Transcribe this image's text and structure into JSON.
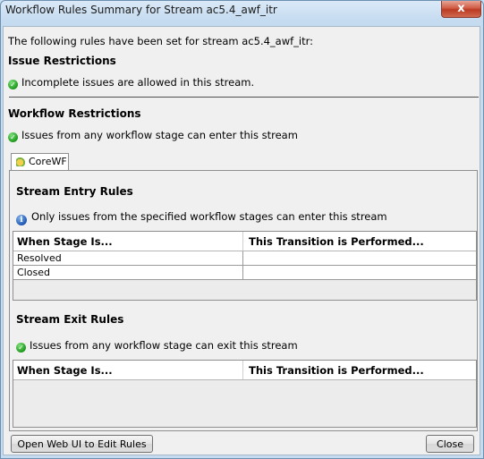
{
  "window": {
    "title": "Workflow Rules Summary for Stream ac5.4_awf_itr",
    "close_glyph": "x"
  },
  "intro": "The following rules have been set for stream ac5.4_awf_itr:",
  "issue_restrictions": {
    "heading": "Issue Restrictions",
    "message": "Incomplete issues are allowed in this stream."
  },
  "workflow_restrictions": {
    "heading": "Workflow Restrictions",
    "message": "Issues from any workflow stage can enter this stream"
  },
  "tab": {
    "label": "CoreWF"
  },
  "entry_rules": {
    "heading": "Stream Entry Rules",
    "message": "Only issues from the specified workflow stages can enter this stream",
    "columns": [
      "When Stage Is...",
      "This Transition is Performed..."
    ],
    "rows": [
      {
        "stage": "Resolved",
        "transition": ""
      },
      {
        "stage": "Closed",
        "transition": ""
      }
    ]
  },
  "exit_rules": {
    "heading": "Stream Exit Rules",
    "message": "Issues from any workflow stage can exit this stream",
    "columns": [
      "When Stage Is...",
      "This Transition is Performed..."
    ]
  },
  "buttons": {
    "open_web_ui": "Open Web UI to Edit Rules",
    "close": "Close"
  },
  "icons": {
    "check": "check-icon",
    "info": "info-icon",
    "tab": "workflow-icon"
  }
}
